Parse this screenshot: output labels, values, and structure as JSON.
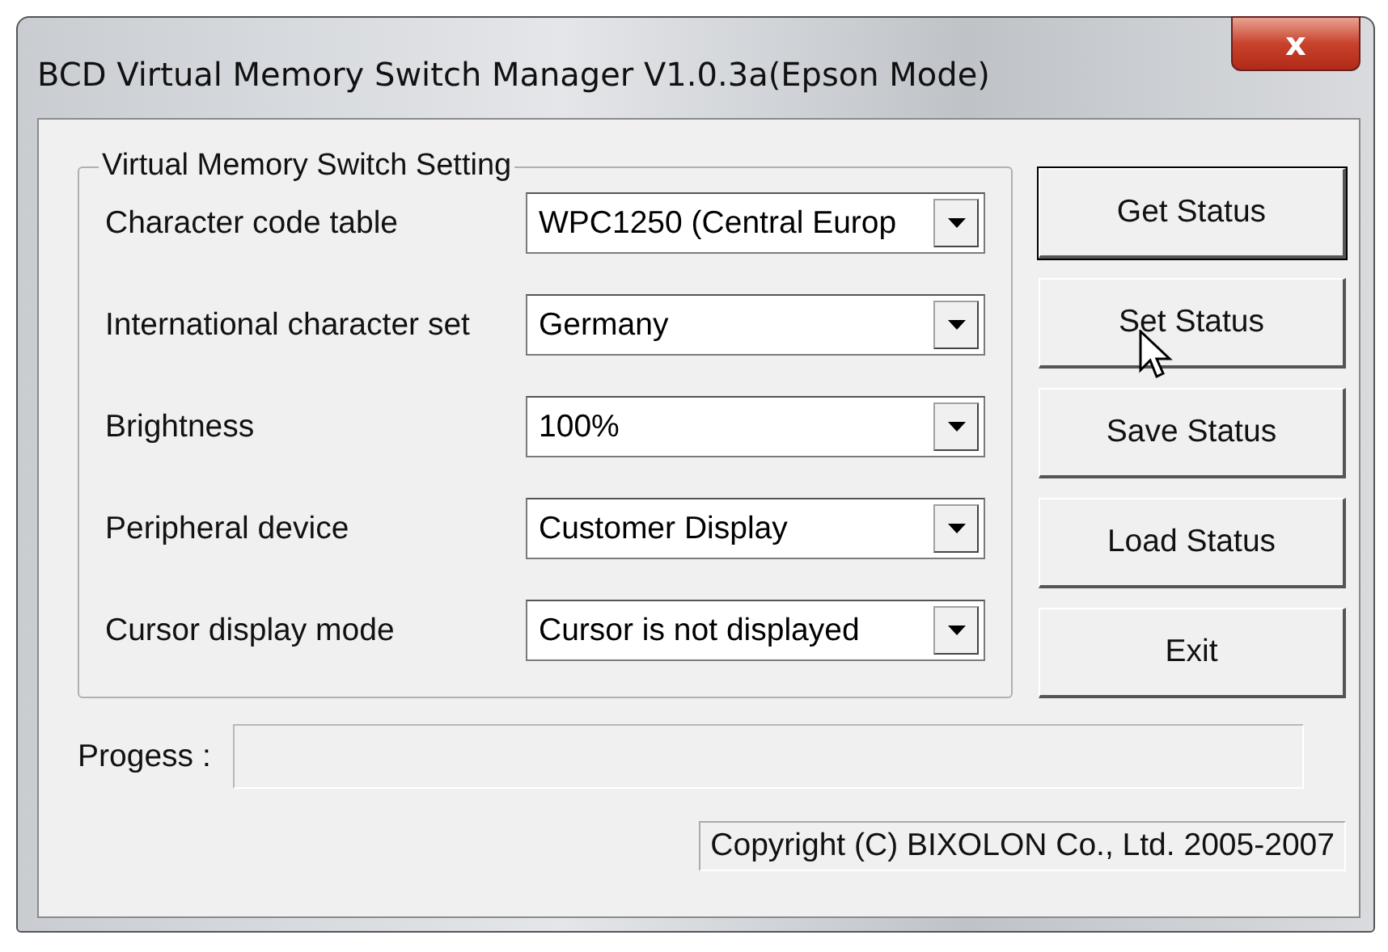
{
  "window": {
    "title": "BCD Virtual Memory Switch Manager V1.0.3a(Epson Mode)",
    "close": "x"
  },
  "group": {
    "title": "Virtual Memory Switch Setting",
    "settings": [
      {
        "label": "Character code table",
        "value": "WPC1250 (Central Europ"
      },
      {
        "label": "International character set",
        "value": "Germany"
      },
      {
        "label": "Brightness",
        "value": "100%"
      },
      {
        "label": "Peripheral device",
        "value": "Customer Display"
      },
      {
        "label": "Cursor display mode",
        "value": "Cursor is not displayed"
      }
    ]
  },
  "buttons": [
    {
      "label": "Get Status",
      "default": true
    },
    {
      "label": "Set Status",
      "default": false
    },
    {
      "label": "Save Status",
      "default": false
    },
    {
      "label": "Load Status",
      "default": false
    },
    {
      "label": "Exit",
      "default": false
    }
  ],
  "progress": {
    "label": "Progess :",
    "level": 0
  },
  "status_bar": {
    "text": "Copyright (C) BIXOLON Co., Ltd. 2005-2007"
  }
}
